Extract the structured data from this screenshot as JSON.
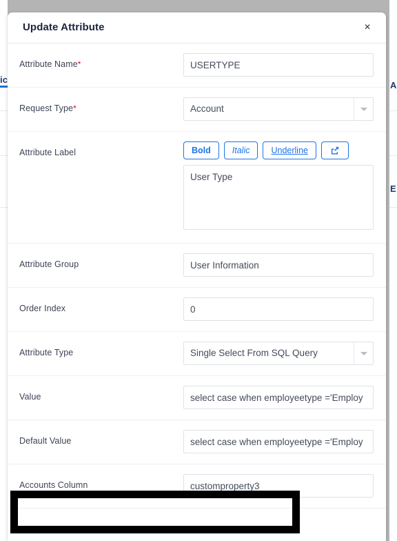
{
  "background": {
    "left_tab_text": "ic",
    "right_text_top": "A",
    "right_text_mid": "E"
  },
  "modal": {
    "title": "Update Attribute",
    "close_icon": "close-icon",
    "close_label": "×"
  },
  "form": {
    "rows": [
      {
        "label": "Attribute Name",
        "required": true,
        "type": "text",
        "value": "USERTYPE",
        "placeholder": "Attribute Name"
      },
      {
        "label": "Request Type",
        "required": true,
        "type": "select",
        "value": "Account"
      },
      {
        "label": "Attribute Label",
        "required": false,
        "type": "richtext",
        "value": "User Type",
        "placeholder": "Attribute Label",
        "toolbar": [
          {
            "label": "Bold",
            "name": "bold-button",
            "style": "bold"
          },
          {
            "label": "Italic",
            "name": "italic-button",
            "style": "italic"
          },
          {
            "label": "Underline",
            "name": "underline-button",
            "style": "underline"
          },
          {
            "label": "",
            "name": "share-link-button",
            "style": "icon"
          }
        ]
      },
      {
        "label": "Attribute Group",
        "required": false,
        "type": "text",
        "value": "User Information",
        "placeholder": "Attribute Group"
      },
      {
        "label": "Order Index",
        "required": false,
        "type": "text",
        "value": "0",
        "placeholder": "Order Index"
      },
      {
        "label": "Attribute Type",
        "required": false,
        "type": "select",
        "value": "Single Select From SQL Query"
      },
      {
        "label": "Value",
        "required": false,
        "type": "text",
        "value": "select case when employeetype ='Employ",
        "placeholder": "Value"
      },
      {
        "label": "Default Value",
        "required": false,
        "type": "text",
        "value": "select case when employeetype ='Employ",
        "placeholder": "Default Value"
      },
      {
        "label": "Accounts Column",
        "required": false,
        "type": "text",
        "value": "customproperty3",
        "placeholder": "Accounts Column"
      }
    ]
  },
  "colors": {
    "accent_blue": "#1a73e8",
    "required_red": "#e4002b",
    "annotation_black": "#000000",
    "page_backdrop": "#b4b4b4"
  }
}
